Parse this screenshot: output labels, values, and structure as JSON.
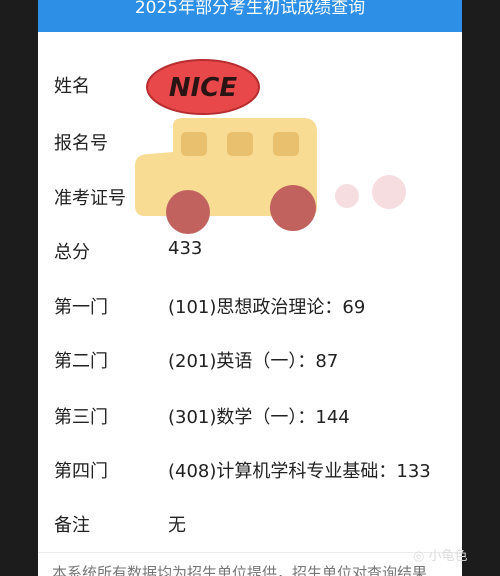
{
  "header": {
    "title": "2025年部分考生初试成绩查询"
  },
  "rows": [
    {
      "label": "姓名",
      "value": ""
    },
    {
      "label": "报名号",
      "value": ""
    },
    {
      "label": "准考证号",
      "value": ""
    },
    {
      "label": "总分",
      "value": "433"
    },
    {
      "label": "第一门",
      "value": "(101)思想政治理论：69"
    },
    {
      "label": "第二门",
      "value": "(201)英语（一）：87"
    },
    {
      "label": "第三门",
      "value": "(301)数学（一）：144"
    },
    {
      "label": "第四门",
      "value": "(408)计算机学科专业基础：133"
    },
    {
      "label": "备注",
      "value": "无"
    }
  ],
  "footer": {
    "text": "本系统所有数据均为招生单位提供，招生单位对查询结果"
  },
  "stickers": {
    "nice_text": "NICE"
  },
  "watermark": {
    "text": "小龟色"
  },
  "colors": {
    "header_bg": "#2d8fe6",
    "nice_red": "#e8484a",
    "bus_yellow": "#f9dc93",
    "wheel": "#c1625e"
  }
}
